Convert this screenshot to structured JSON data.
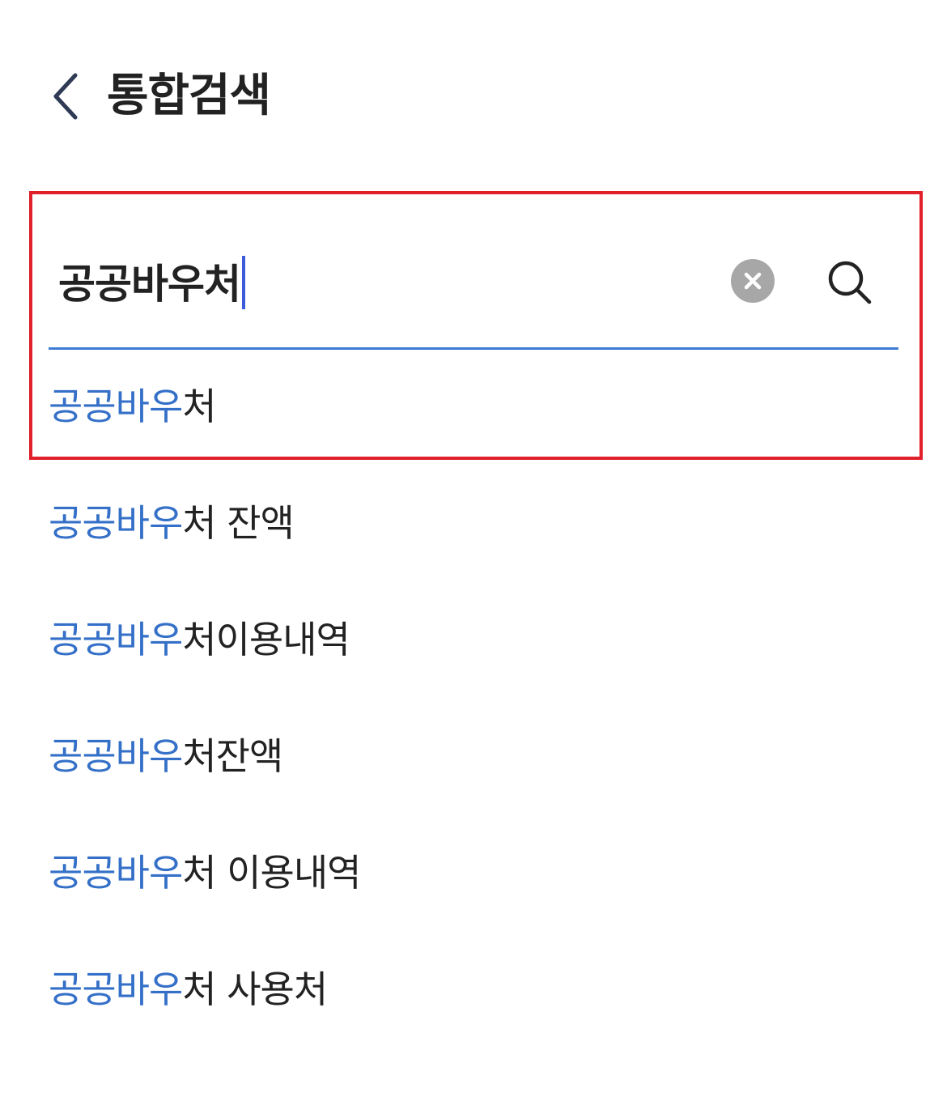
{
  "header": {
    "title": "통합검색",
    "back_icon": "chevron-left-icon"
  },
  "search": {
    "value": "공공바우처",
    "clear_icon": "clear-circle-icon",
    "search_icon": "search-icon"
  },
  "colors": {
    "match_highlight": "#3570c8",
    "underline": "#3d7bd4",
    "annotation_box": "#e0202a",
    "caret": "#3b5bdb"
  },
  "suggestions": [
    {
      "match": "공공바우",
      "rest": "처"
    },
    {
      "match": "공공바우",
      "rest": "처 잔액"
    },
    {
      "match": "공공바우",
      "rest": "처이용내역"
    },
    {
      "match": "공공바우",
      "rest": "처잔액"
    },
    {
      "match": "공공바우",
      "rest": "처 이용내역"
    },
    {
      "match": "공공바우",
      "rest": "처 사용처"
    }
  ]
}
